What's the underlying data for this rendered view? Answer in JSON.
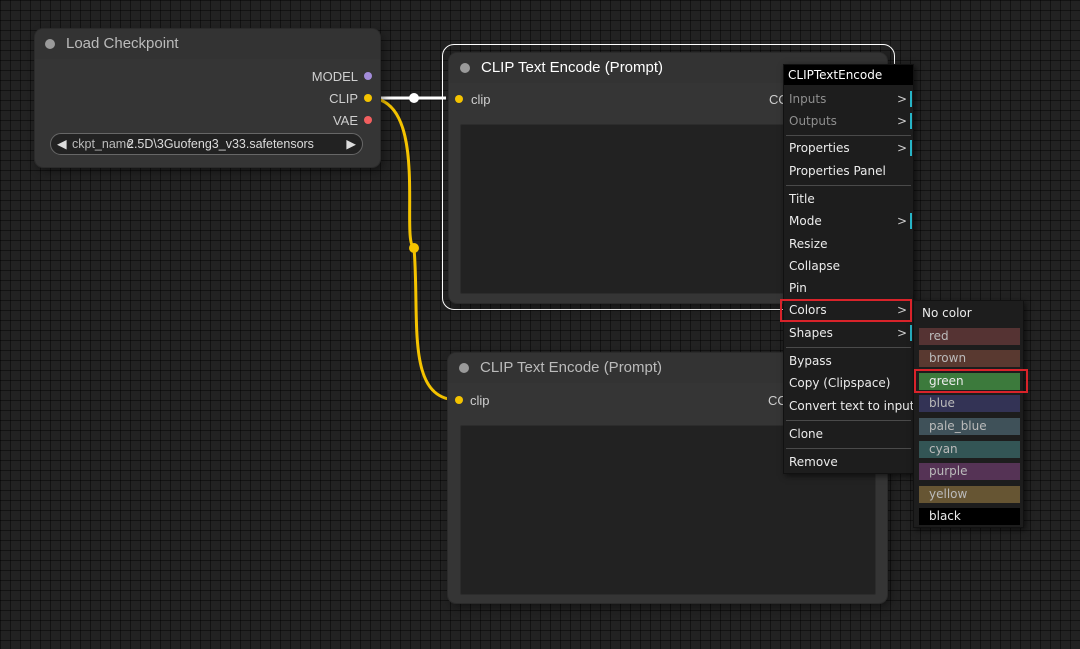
{
  "load_checkpoint": {
    "title": "Load Checkpoint",
    "outputs": [
      "MODEL",
      "CLIP",
      "VAE"
    ],
    "widget_name": "ckpt_name",
    "widget_value": "2.5D\\3Guofeng3_v33.safetensors",
    "colors": {
      "model": "#a38cd9",
      "clip": "#f4c300",
      "vae": "#f25f5f"
    }
  },
  "clip_node_1": {
    "title": "CLIP Text Encode (Prompt)",
    "input_label": "clip",
    "output_label_partial": "CO"
  },
  "clip_node_2": {
    "title": "CLIP Text Encode (Prompt)",
    "input_label": "clip",
    "output_label_partial": "CO"
  },
  "context_menu": {
    "header": "CLIPTextEncode",
    "items": {
      "inputs": "Inputs",
      "outputs": "Outputs",
      "properties": "Properties",
      "properties_panel": "Properties Panel",
      "title": "Title",
      "mode": "Mode",
      "resize": "Resize",
      "collapse": "Collapse",
      "pin": "Pin",
      "colors": "Colors",
      "shapes": "Shapes",
      "bypass": "Bypass",
      "copy_clipspace": "Copy (Clipspace)",
      "convert_text": "Convert text to input",
      "clone": "Clone",
      "remove": "Remove"
    },
    "arrow": ">"
  },
  "colors_submenu": {
    "no_color": "No color",
    "options": [
      {
        "label": "red",
        "bg": "#553333"
      },
      {
        "label": "brown",
        "bg": "#593930"
      },
      {
        "label": "green",
        "bg": "#335533"
      },
      {
        "label": "blue",
        "bg": "#333355"
      },
      {
        "label": "pale_blue",
        "bg": "#3f5159"
      },
      {
        "label": "cyan",
        "bg": "#335555"
      },
      {
        "label": "purple",
        "bg": "#553355"
      },
      {
        "label": "yellow",
        "bg": "#665533"
      },
      {
        "label": "black",
        "bg": "#000000"
      }
    ],
    "selected": "green"
  },
  "theme": {
    "link_color": "#f4c300",
    "highlight_color": "#d9232a",
    "menu_accent": "#27b5c7"
  }
}
